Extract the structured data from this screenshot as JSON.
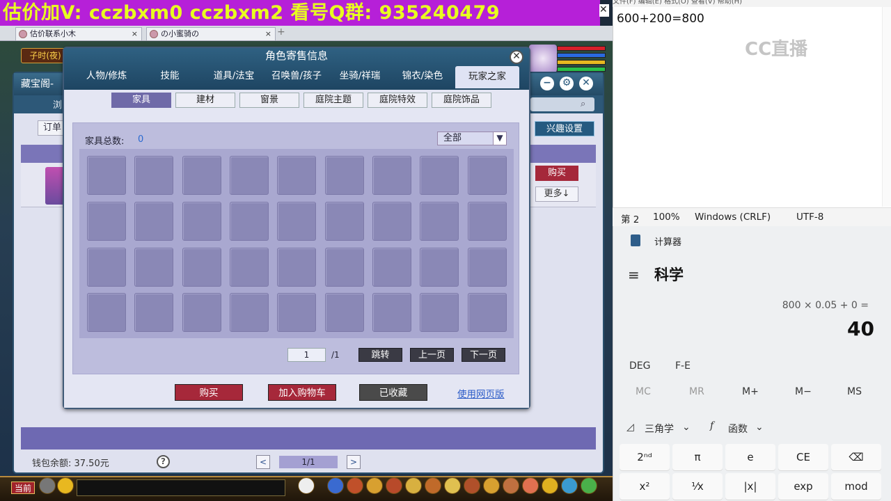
{
  "banner": {
    "text": "估价加V:  cczbxm0  cczbxm2  看号Q群: 935240479",
    "close": "✕"
  },
  "browser_tabs": [
    {
      "label": "估价联系小木",
      "close": "×"
    },
    {
      "label": "の小蜜骑の",
      "close": "×"
    }
  ],
  "new_tab": "+",
  "game_status": "子时(夜)",
  "cangbaoge": {
    "title": "藏宝阁-",
    "tab_partial": "浏",
    "order_label": "订单",
    "interest_button": "兴趣设置",
    "buy_button": "购买",
    "more_button": "更多↓",
    "wallet": "钱包余额: 37.50元",
    "help": "?",
    "prev": "<",
    "page_indicator": "1/1",
    "next": ">"
  },
  "dialog": {
    "title": "角色寄售信息",
    "close": "✕",
    "categories": [
      "人物/修炼",
      "技能",
      "道具/法宝",
      "召唤兽/孩子",
      "坐骑/祥瑞",
      "锦衣/染色",
      "玩家之家"
    ],
    "active_category": "玩家之家",
    "subtabs": [
      "家具",
      "建材",
      "窗景",
      "庭院主题",
      "庭院特效",
      "庭院饰品"
    ],
    "active_subtab": "家具",
    "total_label": "家具总数:",
    "total_value": "0",
    "filter_value": "全部",
    "page_current": "1",
    "page_total": "/1",
    "jump_button": "跳转",
    "prev_button": "上一页",
    "next_button": "下一页",
    "buy_button": "购买",
    "add_cart_button": "加入购物车",
    "collected_button": "已收藏",
    "web_link": "使用网页版"
  },
  "game_bar": {
    "channel": "当前"
  },
  "notepad": {
    "menu": "文件(F)  编辑(E)  格式(O)  查看(V)  帮助(H)",
    "content": "600+200=800",
    "watermark": "CC直播",
    "status": {
      "line": "第 2",
      "zoom": "100%",
      "eol": "Windows (CRLF)",
      "encoding": "UTF-8"
    }
  },
  "calculator": {
    "app_name": "计算器",
    "menu_icon": "≡",
    "mode": "科学",
    "expression": "800 × 0.05 + 0 =",
    "result": "40",
    "angle_unit": "DEG",
    "fe": "F-E",
    "memory": [
      "MC",
      "MR",
      "M+",
      "M−",
      "MS"
    ],
    "trig_label": "三角学",
    "func_label": "函数",
    "keys_row1": [
      "2ⁿᵈ",
      "π",
      "e",
      "CE",
      "⌫"
    ],
    "keys_row2": [
      "x²",
      "¹⁄x",
      "|x|",
      "exp",
      "mod"
    ]
  }
}
